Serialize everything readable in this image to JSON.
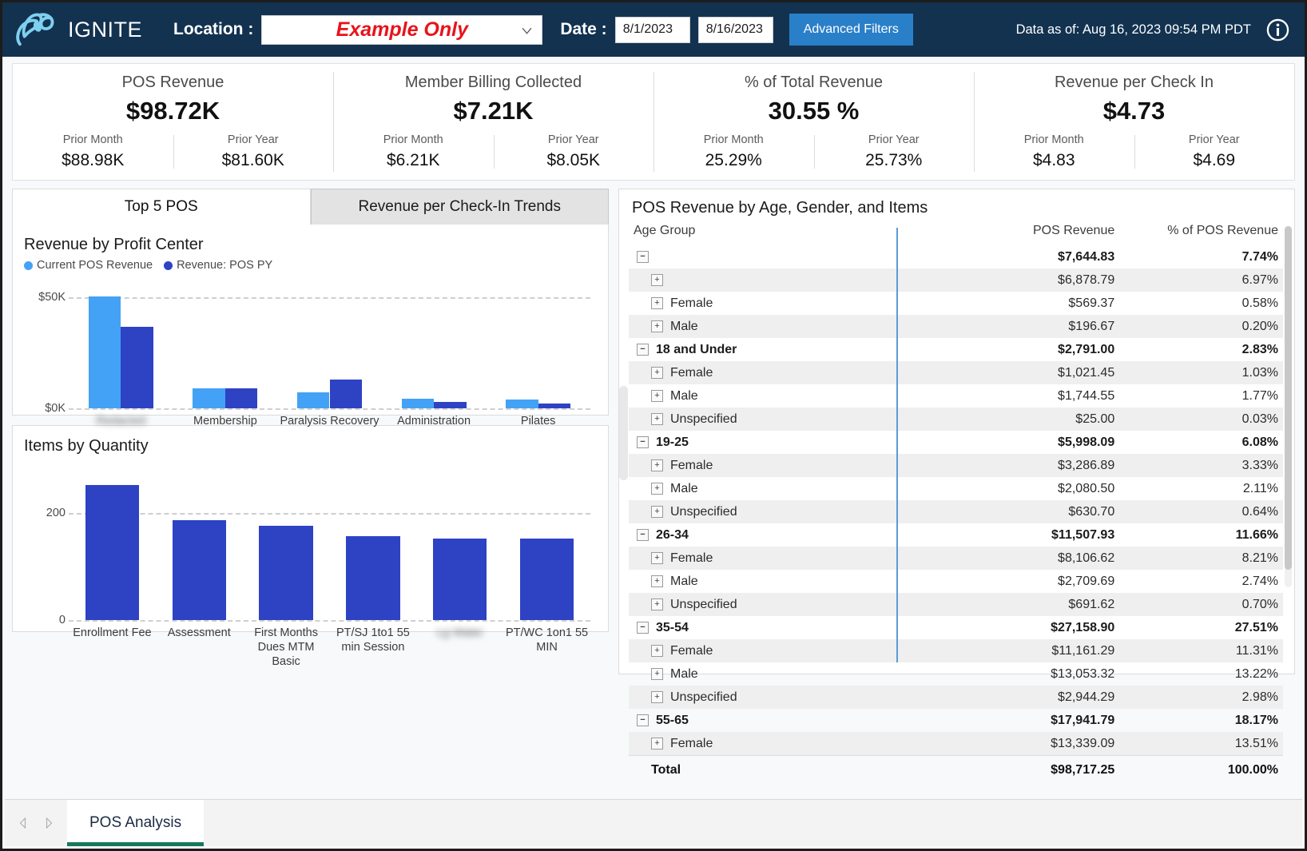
{
  "header": {
    "brand": "IGNITE",
    "location_label": "Location :",
    "location_value": "Example Only",
    "date_label": "Date :",
    "date_from": "8/1/2023",
    "date_to": "8/16/2023",
    "advanced_filters": "Advanced Filters",
    "data_as_of": "Data as of: Aug 16, 2023  09:54 PM PDT",
    "accent": "#2a7fc9",
    "bar_bg": "#123250",
    "location_color": "#e8131a"
  },
  "kpis": [
    {
      "title": "POS Revenue",
      "value": "$98.72K",
      "prior_month_label": "Prior Month",
      "prior_month_value": "$88.98K",
      "prior_year_label": "Prior Year",
      "prior_year_value": "$81.60K"
    },
    {
      "title": "Member Billing Collected",
      "value": "$7.21K",
      "prior_month_label": "Prior Month",
      "prior_month_value": "$6.21K",
      "prior_year_label": "Prior Year",
      "prior_year_value": "$8.05K"
    },
    {
      "title": "% of Total Revenue",
      "value": "30.55 %",
      "prior_month_label": "Prior Month",
      "prior_month_value": "25.29%",
      "prior_year_label": "Prior Year",
      "prior_year_value": "25.73%"
    },
    {
      "title": "Revenue per Check In",
      "value": "$4.73",
      "prior_month_label": "Prior Month",
      "prior_month_value": "$4.83",
      "prior_year_label": "Prior Year",
      "prior_year_value": "$4.69"
    }
  ],
  "tabs": [
    {
      "label": "Top 5 POS",
      "active": true
    },
    {
      "label": "Revenue per Check-In Trends",
      "active": false
    }
  ],
  "chart_data": [
    {
      "type": "bar",
      "title": "Revenue by Profit Center",
      "xlabel": "",
      "ylabel": "",
      "ylim": [
        0,
        57000
      ],
      "yticks": [
        0,
        50000
      ],
      "ytick_labels": [
        "$0K",
        "$50K"
      ],
      "grid": true,
      "legend_position": "top-left",
      "categories": [
        "",
        "Membership",
        "Paralysis Recovery",
        "Administration",
        "Pilates"
      ],
      "categories_redacted": [
        true,
        false,
        false,
        false,
        false
      ],
      "series": [
        {
          "name": "Current POS Revenue",
          "color": "#43a2f5",
          "values": [
            50200,
            9100,
            7200,
            4200,
            3900
          ]
        },
        {
          "name": "Revenue: POS PY",
          "color": "#2e42c4",
          "values": [
            36500,
            9000,
            13000,
            2900,
            2200
          ]
        }
      ]
    },
    {
      "type": "bar",
      "title": "Items by Quantity",
      "xlabel": "",
      "ylabel": "",
      "ylim": [
        0,
        275
      ],
      "yticks": [
        0,
        200
      ],
      "ytick_labels": [
        "0",
        "200"
      ],
      "grid": true,
      "categories": [
        "Enrollment Fee",
        "Assessment",
        "First Months Dues MTM Basic",
        "PT/SJ 1to1 55 min Session",
        "Lg Water",
        "PT/WC 1on1 55 MIN"
      ],
      "categories_redacted": [
        false,
        false,
        false,
        false,
        true,
        false
      ],
      "series": [
        {
          "name": "Quantity",
          "color": "#2e42c4",
          "values": [
            252,
            187,
            177,
            157,
            152,
            152
          ]
        }
      ]
    }
  ],
  "table": {
    "title": "POS Revenue by Age, Gender, and Items",
    "columns": [
      "Age Group",
      "POS Revenue",
      "% of POS Revenue"
    ],
    "rows": [
      {
        "toggle": "minus",
        "indent": 0,
        "label": "",
        "revenue": "$7,644.83",
        "pct": "7.74%",
        "group": true,
        "alt": false
      },
      {
        "toggle": "plus",
        "indent": 1,
        "label": "",
        "revenue": "$6,878.79",
        "pct": "6.97%",
        "group": false,
        "alt": true
      },
      {
        "toggle": "plus",
        "indent": 1,
        "label": "Female",
        "revenue": "$569.37",
        "pct": "0.58%",
        "group": false,
        "alt": false
      },
      {
        "toggle": "plus",
        "indent": 1,
        "label": "Male",
        "revenue": "$196.67",
        "pct": "0.20%",
        "group": false,
        "alt": true
      },
      {
        "toggle": "minus",
        "indent": 0,
        "label": "18 and Under",
        "revenue": "$2,791.00",
        "pct": "2.83%",
        "group": true,
        "alt": false
      },
      {
        "toggle": "plus",
        "indent": 1,
        "label": "Female",
        "revenue": "$1,021.45",
        "pct": "1.03%",
        "group": false,
        "alt": true
      },
      {
        "toggle": "plus",
        "indent": 1,
        "label": "Male",
        "revenue": "$1,744.55",
        "pct": "1.77%",
        "group": false,
        "alt": false
      },
      {
        "toggle": "plus",
        "indent": 1,
        "label": "Unspecified",
        "revenue": "$25.00",
        "pct": "0.03%",
        "group": false,
        "alt": true
      },
      {
        "toggle": "minus",
        "indent": 0,
        "label": "19-25",
        "revenue": "$5,998.09",
        "pct": "6.08%",
        "group": true,
        "alt": false
      },
      {
        "toggle": "plus",
        "indent": 1,
        "label": "Female",
        "revenue": "$3,286.89",
        "pct": "3.33%",
        "group": false,
        "alt": true
      },
      {
        "toggle": "plus",
        "indent": 1,
        "label": "Male",
        "revenue": "$2,080.50",
        "pct": "2.11%",
        "group": false,
        "alt": false
      },
      {
        "toggle": "plus",
        "indent": 1,
        "label": "Unspecified",
        "revenue": "$630.70",
        "pct": "0.64%",
        "group": false,
        "alt": true
      },
      {
        "toggle": "minus",
        "indent": 0,
        "label": "26-34",
        "revenue": "$11,507.93",
        "pct": "11.66%",
        "group": true,
        "alt": false
      },
      {
        "toggle": "plus",
        "indent": 1,
        "label": "Female",
        "revenue": "$8,106.62",
        "pct": "8.21%",
        "group": false,
        "alt": true
      },
      {
        "toggle": "plus",
        "indent": 1,
        "label": "Male",
        "revenue": "$2,709.69",
        "pct": "2.74%",
        "group": false,
        "alt": false
      },
      {
        "toggle": "plus",
        "indent": 1,
        "label": "Unspecified",
        "revenue": "$691.62",
        "pct": "0.70%",
        "group": false,
        "alt": true
      },
      {
        "toggle": "minus",
        "indent": 0,
        "label": "35-54",
        "revenue": "$27,158.90",
        "pct": "27.51%",
        "group": true,
        "alt": false
      },
      {
        "toggle": "plus",
        "indent": 1,
        "label": "Female",
        "revenue": "$11,161.29",
        "pct": "11.31%",
        "group": false,
        "alt": true
      },
      {
        "toggle": "plus",
        "indent": 1,
        "label": "Male",
        "revenue": "$13,053.32",
        "pct": "13.22%",
        "group": false,
        "alt": false
      },
      {
        "toggle": "plus",
        "indent": 1,
        "label": "Unspecified",
        "revenue": "$2,944.29",
        "pct": "2.98%",
        "group": false,
        "alt": true
      },
      {
        "toggle": "minus",
        "indent": 0,
        "label": "55-65",
        "revenue": "$17,941.79",
        "pct": "18.17%",
        "group": true,
        "alt": false
      },
      {
        "toggle": "plus",
        "indent": 1,
        "label": "Female",
        "revenue": "$13,339.09",
        "pct": "13.51%",
        "group": false,
        "alt": true
      }
    ],
    "total": {
      "label": "Total",
      "revenue": "$98,717.25",
      "pct": "100.00%"
    }
  },
  "footer": {
    "page_tab": "POS Analysis",
    "prev_icon": "triangle-left-icon",
    "next_icon": "triangle-right-icon",
    "underline_color": "#16795f"
  }
}
